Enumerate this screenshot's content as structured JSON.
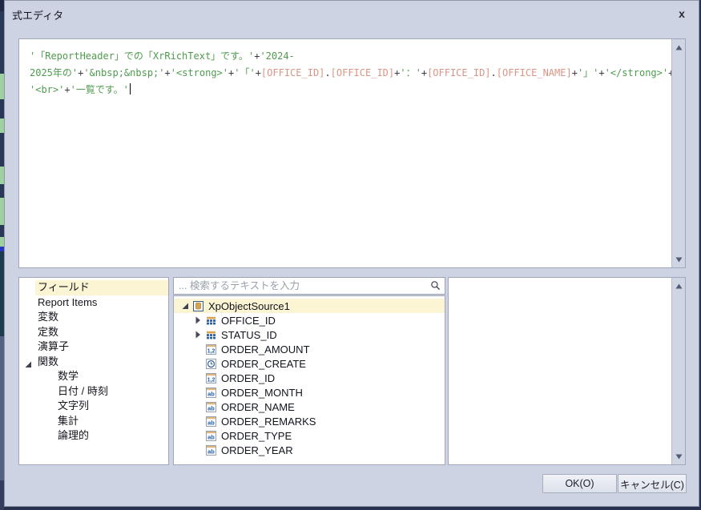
{
  "window": {
    "title": "式エディタ",
    "close_glyph": "x"
  },
  "expression": {
    "caret_visible": true,
    "lines": [
      [
        {
          "t": "str",
          "v": "'「ReportHeader」での「XrRichText」です。'"
        },
        {
          "t": "op",
          "v": "+"
        },
        {
          "t": "str",
          "v": "'2024-"
        }
      ],
      [
        {
          "t": "str",
          "v": "2025年の'"
        },
        {
          "t": "op",
          "v": "+"
        },
        {
          "t": "str",
          "v": "'&nbsp;&nbsp;'"
        },
        {
          "t": "op",
          "v": "+"
        },
        {
          "t": "str",
          "v": "'<strong>'"
        },
        {
          "t": "op",
          "v": "+"
        },
        {
          "t": "str",
          "v": "'「'"
        },
        {
          "t": "op",
          "v": "+"
        },
        {
          "t": "field",
          "v": "[OFFICE_ID]"
        },
        {
          "t": "op",
          "v": "."
        },
        {
          "t": "field",
          "v": "[OFFICE_ID]"
        },
        {
          "t": "op",
          "v": "+"
        },
        {
          "t": "str",
          "v": "'："
        },
        {
          "t": "str",
          "v": "'"
        },
        {
          "t": "op",
          "v": "+"
        },
        {
          "t": "field",
          "v": "[OFFICE_ID]"
        },
        {
          "t": "op",
          "v": "."
        },
        {
          "t": "field",
          "v": "[OFFICE_NAME]"
        },
        {
          "t": "op",
          "v": "+"
        },
        {
          "t": "str",
          "v": "'」'"
        },
        {
          "t": "op",
          "v": "+"
        },
        {
          "t": "str",
          "v": "'</strong>'"
        },
        {
          "t": "op",
          "v": "+"
        }
      ],
      [
        {
          "t": "str",
          "v": "'<br>'"
        },
        {
          "t": "op",
          "v": "+"
        },
        {
          "t": "str",
          "v": "'一覧です。'"
        }
      ]
    ]
  },
  "categories": {
    "items": [
      {
        "label": "フィールド",
        "level": 0,
        "selected": true
      },
      {
        "label": "Report Items",
        "level": 0
      },
      {
        "label": "変数",
        "level": 0
      },
      {
        "label": "定数",
        "level": 0
      },
      {
        "label": "演算子",
        "level": 0
      },
      {
        "label": "関数",
        "level": 0,
        "expanded": true
      },
      {
        "label": "数学",
        "level": 1
      },
      {
        "label": "日付 / 時刻",
        "level": 1
      },
      {
        "label": "文字列",
        "level": 1
      },
      {
        "label": "集計",
        "level": 1
      },
      {
        "label": "論理的",
        "level": 1
      }
    ]
  },
  "search": {
    "placeholder": "... 検索するテキストを入力"
  },
  "fields_tree": {
    "items": [
      {
        "label": "XpObjectSource1",
        "icon": "database",
        "expander": "expanded",
        "level": 0,
        "selected": true
      },
      {
        "label": "OFFICE_ID",
        "icon": "table",
        "expander": "collapsed",
        "level": 1
      },
      {
        "label": "STATUS_ID",
        "icon": "table",
        "expander": "collapsed",
        "level": 1
      },
      {
        "label": "ORDER_AMOUNT",
        "icon": "number",
        "level": 1
      },
      {
        "label": "ORDER_CREATE",
        "icon": "datetime",
        "level": 1
      },
      {
        "label": "ORDER_ID",
        "icon": "number",
        "level": 1
      },
      {
        "label": "ORDER_MONTH",
        "icon": "text",
        "level": 1
      },
      {
        "label": "ORDER_NAME",
        "icon": "text",
        "level": 1
      },
      {
        "label": "ORDER_REMARKS",
        "icon": "text",
        "level": 1
      },
      {
        "label": "ORDER_TYPE",
        "icon": "text",
        "level": 1
      },
      {
        "label": "ORDER_YEAR",
        "icon": "text",
        "level": 1
      }
    ]
  },
  "description_panel": {
    "text": ""
  },
  "footer": {
    "ok_label": "OK(O)",
    "cancel_label": "キャンセル(C)"
  },
  "colors": {
    "dialog_bg": "#cdd3e2",
    "string_literal": "#4e9b4e",
    "field_reference": "#db9484",
    "operator": "#3c3c44",
    "selection_highlight": "#fcf5d3",
    "panel_border": "#9fa7b9",
    "footer_edge": "#28324e"
  }
}
